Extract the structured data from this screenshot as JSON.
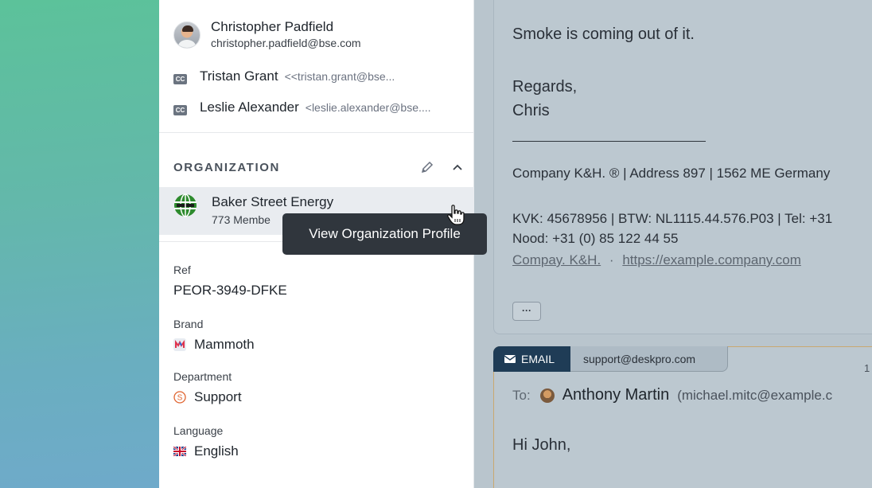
{
  "contact": {
    "name": "Christopher Padfield",
    "email": "christopher.padfield@bse.com"
  },
  "cc": [
    {
      "badge": "CC",
      "name": "Tristan Grant",
      "email": "<<tristan.grant@bse..."
    },
    {
      "badge": "CC",
      "name": "Leslie Alexander",
      "email": "<leslie.alexander@bse...."
    }
  ],
  "organization": {
    "section_title": "ORGANIZATION",
    "name": "Baker Street Energy",
    "members": "773 Membe",
    "tooltip": "View Organization Profile"
  },
  "fields": {
    "ref": {
      "label": "Ref",
      "value": "PEOR-3949-DFKE"
    },
    "brand": {
      "label": "Brand",
      "value": "Mammoth",
      "icon": "mammoth-brand-icon"
    },
    "department": {
      "label": "Department",
      "value": "Support",
      "icon": "support-s-icon"
    },
    "language": {
      "label": "Language",
      "value": "English",
      "icon": "uk-flag-icon"
    }
  },
  "message": {
    "line1": "Smoke is coming out of it.",
    "regards": "Regards,",
    "sign": "Chris",
    "company_line": "Company K&H. ® | Address 897 | 1562 ME Germany",
    "kvk_line": "KVK: 45678956 | BTW: NL1115.44.576.P03 | Tel: +31",
    "nood_line": "Nood: +31 (0) 85 122 44 55",
    "link1": "Compay. K&H.",
    "separator": "·",
    "link2": "https://example.company.com",
    "more_button": "···"
  },
  "reply": {
    "tab_label": "EMAIL",
    "from": "support@deskpro.com",
    "date_fragment": "1",
    "to_label": "To:",
    "to_name": "Anthony Martin",
    "to_email": "(michael.mitc@example.c",
    "greeting": "Hi John,"
  },
  "colors": {
    "email_tab": "#1f3c56",
    "tooltip": "#30363d",
    "org_row_bg": "#e9ecf0"
  }
}
